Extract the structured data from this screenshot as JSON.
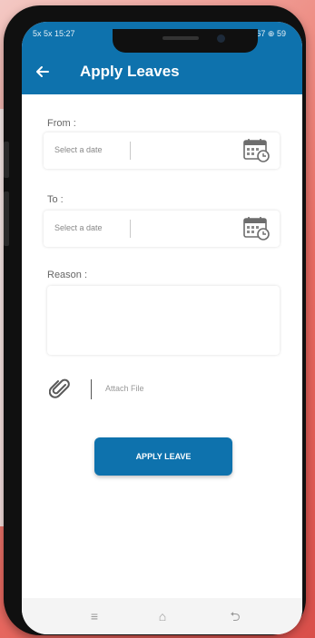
{
  "status": {
    "left": "5x 5x 15:27",
    "right": "67 ⊕ 59"
  },
  "appbar": {
    "back_icon": "arrow-left-icon",
    "title": "Apply Leaves"
  },
  "form": {
    "from_label": "From :",
    "from_placeholder": "Select a date",
    "to_label": "To :",
    "to_placeholder": "Select a date",
    "reason_label": "Reason :",
    "attach_label": "Attach File"
  },
  "actions": {
    "apply_label": "APPLY LEAVE"
  },
  "nav": {
    "menu_icon": "≡",
    "home_icon": "⌂",
    "back_icon": "⮌"
  },
  "colors": {
    "primary": "#0e72ad",
    "background": "#ffffff"
  }
}
